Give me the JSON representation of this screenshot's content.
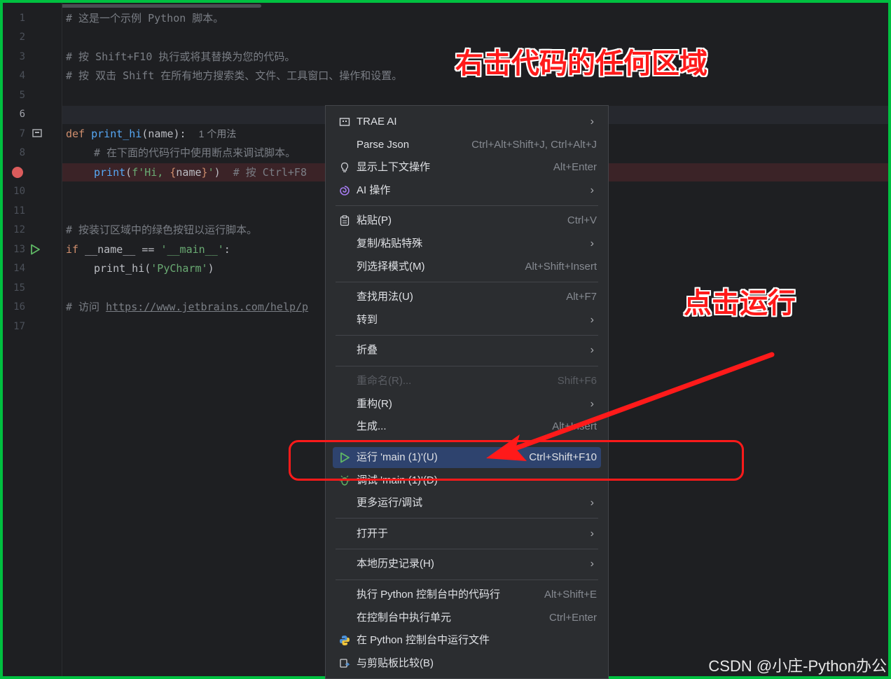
{
  "editor": {
    "line_numbers": [
      "1",
      "2",
      "3",
      "4",
      "5",
      "6",
      "7",
      "8",
      "",
      "10",
      "11",
      "12",
      "13",
      "14",
      "15",
      "16",
      "17"
    ],
    "lines": {
      "l1": "# 这是一个示例 Python 脚本。",
      "l3": "# 按 Shift+F10 执行或将其替换为您的代码。",
      "l4": "# 按 双击 Shift 在所有地方搜索类、文件、工具窗口、操作和设置。",
      "l7_def": "def ",
      "l7_fn": "print_hi",
      "l7_rest": "(name):",
      "l7_hint": "1 个用法",
      "l8": "# 在下面的代码行中使用断点来调试脚本。",
      "l9_fn": "print",
      "l9_a": "(",
      "l9_str1": "f'Hi, ",
      "l9_brace1": "{",
      "l9_name": "name",
      "l9_brace2": "}",
      "l9_str2": "'",
      "l9_b": ")",
      "l9_cm": "# 按 Ctrl+F8",
      "l12": "# 按装订区域中的绿色按钮以运行脚本。",
      "l13_if": "if ",
      "l13_rest": "__name__ == ",
      "l13_str": "'__main__'",
      "l13_colon": ":",
      "l14_fn": "print_hi(",
      "l14_str": "'PyCharm'",
      "l14_close": ")",
      "l16_cm": "# 访问 ",
      "l16_link": "https://www.jetbrains.com/help/p"
    }
  },
  "context_menu": {
    "items": [
      {
        "label": "TRAE AI",
        "shortcut": "",
        "submenu": true,
        "icon": "trae-icon"
      },
      {
        "label": "Parse Json",
        "shortcut": "Ctrl+Alt+Shift+J, Ctrl+Alt+J",
        "submenu": false,
        "icon": ""
      },
      {
        "label": "显示上下文操作",
        "shortcut": "Alt+Enter",
        "submenu": false,
        "icon": "bulb-icon"
      },
      {
        "label": "AI 操作",
        "shortcut": "",
        "submenu": true,
        "icon": "ai-icon"
      },
      {
        "label": "粘贴(P)",
        "shortcut": "Ctrl+V",
        "submenu": false,
        "icon": "paste-icon"
      },
      {
        "label": "复制/粘贴特殊",
        "shortcut": "",
        "submenu": true,
        "icon": ""
      },
      {
        "label": "列选择模式(M)",
        "shortcut": "Alt+Shift+Insert",
        "submenu": false,
        "icon": ""
      },
      {
        "label": "查找用法(U)",
        "shortcut": "Alt+F7",
        "submenu": false,
        "icon": ""
      },
      {
        "label": "转到",
        "shortcut": "",
        "submenu": true,
        "icon": ""
      },
      {
        "label": "折叠",
        "shortcut": "",
        "submenu": true,
        "icon": ""
      },
      {
        "label": "重命名(R)...",
        "shortcut": "Shift+F6",
        "submenu": false,
        "icon": "",
        "disabled": true
      },
      {
        "label": "重构(R)",
        "shortcut": "",
        "submenu": true,
        "icon": ""
      },
      {
        "label": "生成...",
        "shortcut": "Alt+Insert",
        "submenu": false,
        "icon": ""
      },
      {
        "label": "运行 'main (1)'(U)",
        "shortcut": "Ctrl+Shift+F10",
        "submenu": false,
        "icon": "run-icon",
        "selected": true
      },
      {
        "label": "调试 'main (1)'(D)",
        "shortcut": "",
        "submenu": false,
        "icon": "debug-icon"
      },
      {
        "label": "更多运行/调试",
        "shortcut": "",
        "submenu": true,
        "icon": ""
      },
      {
        "label": "打开于",
        "shortcut": "",
        "submenu": true,
        "icon": ""
      },
      {
        "label": "本地历史记录(H)",
        "shortcut": "",
        "submenu": true,
        "icon": ""
      },
      {
        "label": "执行 Python 控制台中的代码行",
        "shortcut": "Alt+Shift+E",
        "submenu": false,
        "icon": ""
      },
      {
        "label": "在控制台中执行单元",
        "shortcut": "Ctrl+Enter",
        "submenu": false,
        "icon": ""
      },
      {
        "label": "在 Python 控制台中运行文件",
        "shortcut": "",
        "submenu": false,
        "icon": "python-icon"
      },
      {
        "label": "与剪贴板比较(B)",
        "shortcut": "",
        "submenu": false,
        "icon": "compare-icon"
      }
    ]
  },
  "annotations": {
    "top": "右击代码的任何区域",
    "middle": "点击运行"
  },
  "watermark": "CSDN @小庄-Python办公",
  "colors": {
    "background": "#1e1f22",
    "menu": "#2b2d30",
    "selected": "#2e436e",
    "annotation": "#ff1a1a",
    "border": "#00c040"
  }
}
